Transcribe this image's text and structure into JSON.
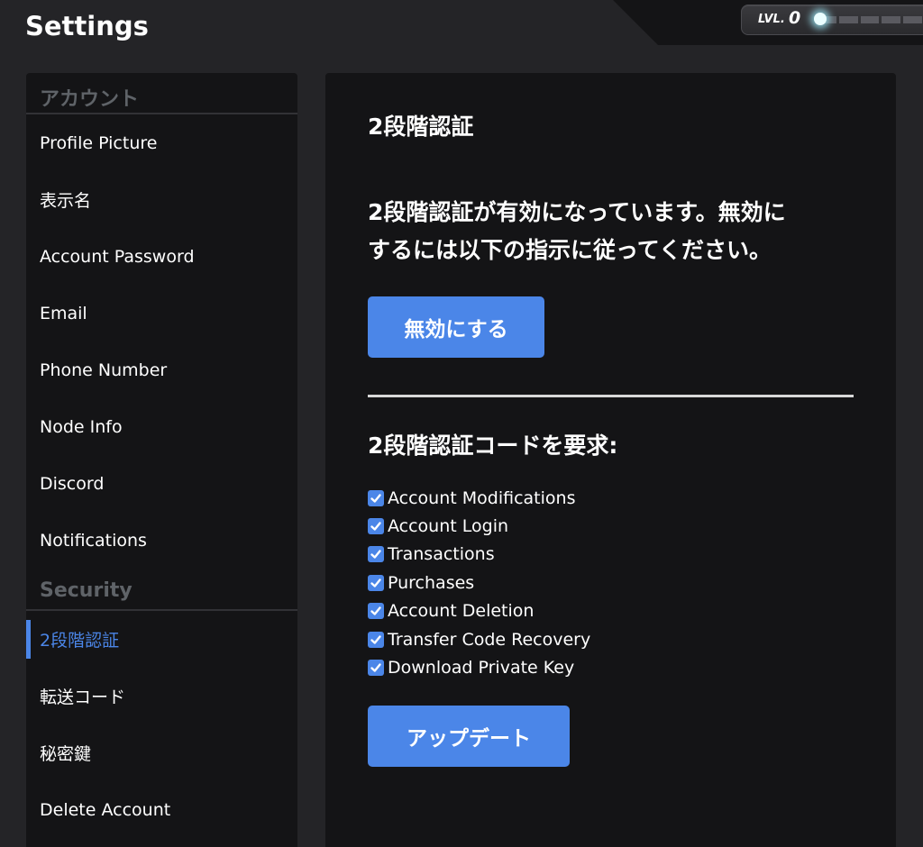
{
  "header": {
    "title": "Settings",
    "level_label": "LVL.",
    "level_value": "0"
  },
  "sidebar": {
    "account_heading": "アカウント",
    "account_items": [
      "Profile Picture",
      "表示名",
      "Account Password",
      "Email",
      "Phone Number",
      "Node Info",
      "Discord",
      "Notifications"
    ],
    "security_heading": "Security",
    "security_items": [
      "2段階認証",
      "転送コード",
      "秘密鍵",
      "Delete Account"
    ],
    "active_item": "2段階認証"
  },
  "panel": {
    "title": "2段階認証",
    "status_line1": "2段階認証が有効になっています。無効に",
    "status_line2": "するには以下の指示に従ってください。",
    "disable_button": "無効にする",
    "require_heading": "2段階認証コードを要求:",
    "options": [
      {
        "label": "Account Modifications",
        "checked": true
      },
      {
        "label": "Account Login",
        "checked": true
      },
      {
        "label": "Transactions",
        "checked": true
      },
      {
        "label": "Purchases",
        "checked": true
      },
      {
        "label": "Account Deletion",
        "checked": true
      },
      {
        "label": "Transfer Code Recovery",
        "checked": true
      },
      {
        "label": "Download Private Key",
        "checked": true
      }
    ],
    "update_button": "アップデート"
  },
  "colors": {
    "accent": "#4b86e8",
    "background": "#242427",
    "panel": "#141416",
    "muted_heading": "#5f6368"
  }
}
